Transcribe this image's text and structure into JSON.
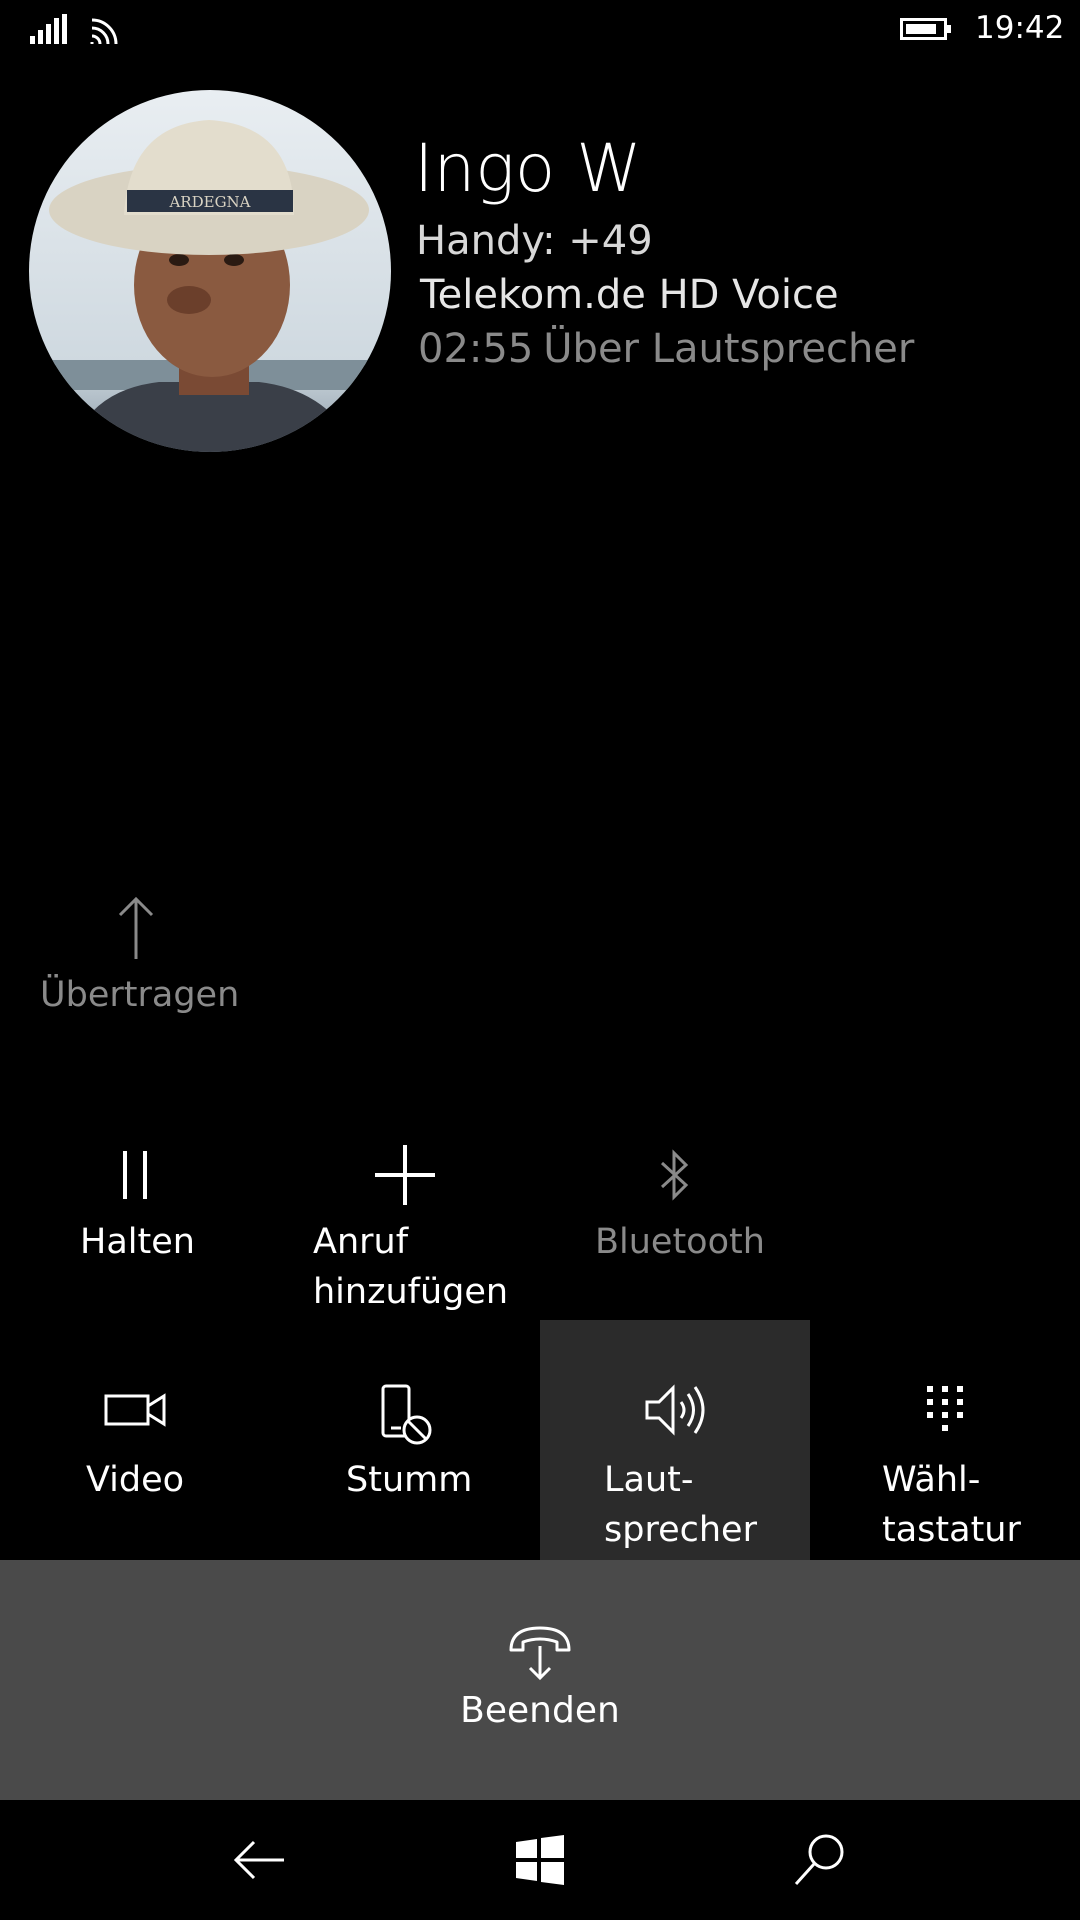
{
  "status_bar": {
    "time": "19:42",
    "icons": [
      "signal-icon",
      "wifi-icon",
      "battery-icon"
    ]
  },
  "contact": {
    "name": "Ingo W",
    "number": "Handy: +49",
    "carrier": "Telekom.de HD Voice",
    "duration": "02:55",
    "mode": "Über Lautsprecher"
  },
  "transfer": {
    "label": "Übertragen",
    "icon": "arrow-up-icon"
  },
  "actions_row1": [
    {
      "label": "Halten",
      "icon": "pause-icon"
    },
    {
      "label": "Anruf\nhinzufügen",
      "icon": "plus-icon"
    },
    {
      "label": "Bluetooth",
      "icon": "bluetooth-icon",
      "disabled": true
    }
  ],
  "actions_row2": [
    {
      "label": "Video",
      "icon": "video-camera-icon"
    },
    {
      "label": "Stumm",
      "icon": "mute-phone-icon"
    },
    {
      "label": "Laut-\nsprecher",
      "icon": "speaker-icon",
      "active": true
    },
    {
      "label": "Wähl-\ntastatur",
      "icon": "keypad-icon"
    }
  ],
  "end_call": {
    "label": "Beenden",
    "icon": "hang-up-icon"
  },
  "nav": [
    "back-icon",
    "windows-start-icon",
    "search-icon"
  ],
  "colors": {
    "background": "#000000",
    "active_tile": "#2b2b2b",
    "end_bar": "#4a4a4a",
    "disabled_text": "#8a8a8a"
  }
}
